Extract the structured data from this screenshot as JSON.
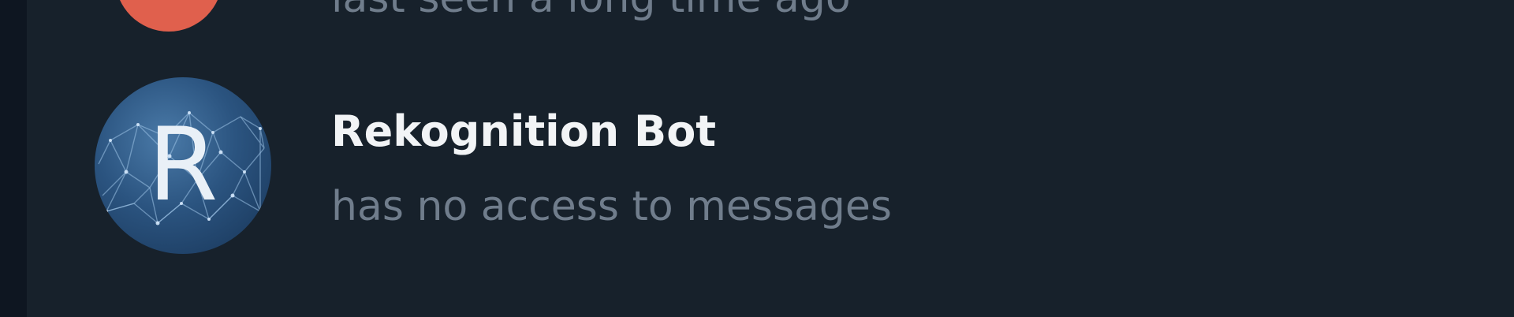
{
  "members": [
    {
      "name": "",
      "status": "last seen a long time ago",
      "avatar_color": "#e0604d"
    },
    {
      "name": "Rekognition Bot",
      "status": "has no access to messages",
      "avatar_letter": "R",
      "avatar_color": "#2b5480"
    }
  ],
  "colors": {
    "background": "#17212b",
    "left_edge": "#0e1621",
    "name_text": "#f2f4f6",
    "status_text": "#707d8c"
  }
}
